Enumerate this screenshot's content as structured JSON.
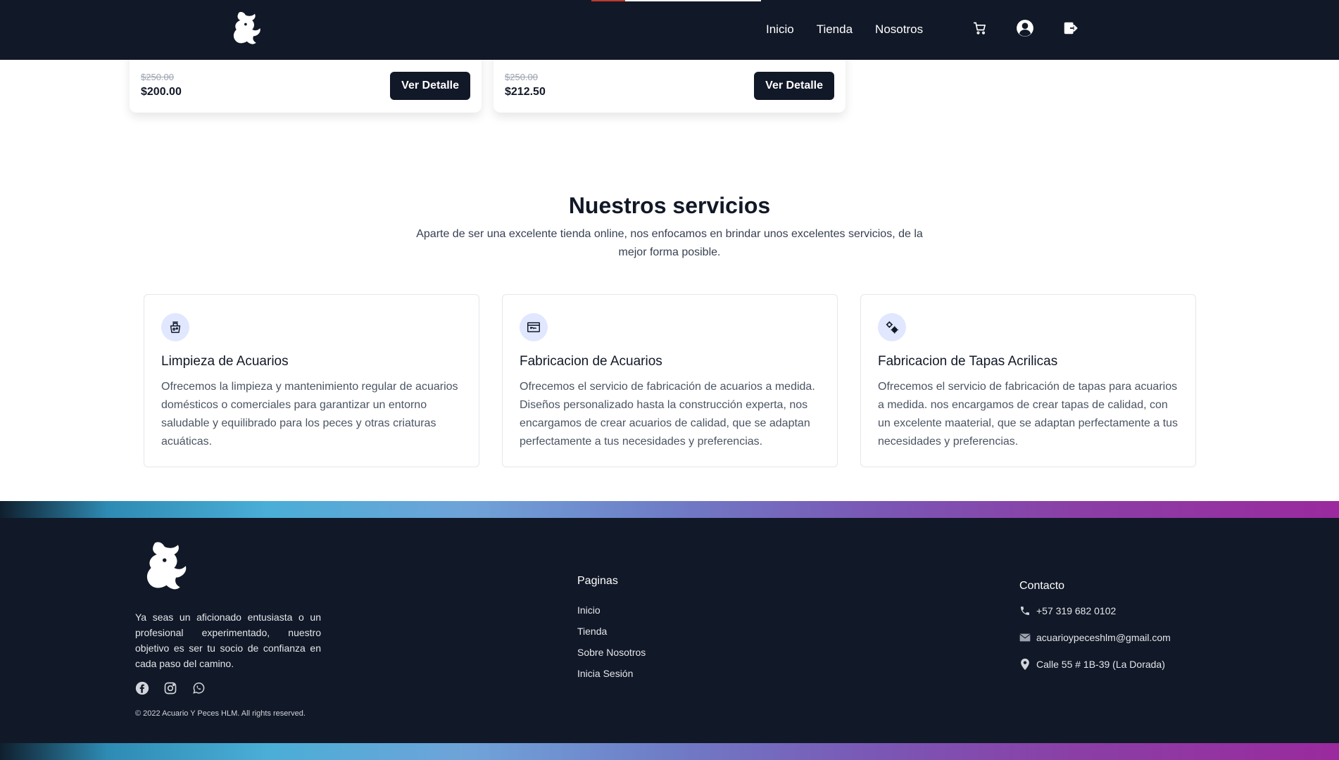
{
  "header": {
    "nav": [
      "Inicio",
      "Tienda",
      "Nosotros"
    ],
    "icons": [
      "cart-icon",
      "user-account-icon",
      "logout-icon"
    ],
    "scroll_progress": 0.2
  },
  "products": [
    {
      "old_price": "$250.00",
      "price": "$200.00",
      "button": "Ver Detalle"
    },
    {
      "old_price": "$250.00",
      "price": "$212.50",
      "button": "Ver Detalle"
    }
  ],
  "services": {
    "title": "Nuestros servicios",
    "subtitle": "Aparte de ser una excelente tienda online, nos enfocamos en brindar unos excelentes servicios, de la mejor forma posible.",
    "items": [
      {
        "icon": "aquarium-cleaning-icon",
        "title": "Limpieza de Acuarios",
        "description": "Ofrecemos la limpieza y mantenimiento regular de acuarios domésticos o comerciales para garantizar un entorno saludable y equilibrado para los peces y otras criaturas acuáticas."
      },
      {
        "icon": "aquarium-tank-icon",
        "title": "Fabricacion de Acuarios",
        "description": "Ofrecemos el servicio de fabricación de acuarios a medida. Diseños personalizado hasta la construcción experta, nos encargamos de crear acuarios de calidad, que se adaptan perfectamente a tus necesidades y preferencias."
      },
      {
        "icon": "gears-icon",
        "title": "Fabricacion de Tapas Acrilicas",
        "description": "Ofrecemos el servicio de fabricación de tapas para acuarios a medida. nos encargamos de crear tapas de calidad, con un excelente maaterial, que se adaptan perfectamente a tus necesidades y preferencias."
      }
    ]
  },
  "footer": {
    "about": "Ya seas un aficionado entusiasta o un profesional experimentado, nuestro objetivo es ser tu socio de confianza en cada paso del camino.",
    "socials": [
      "facebook-icon",
      "instagram-icon",
      "whatsapp-icon"
    ],
    "copyright": "© 2022 Acuario Y Peces HLM. All rights reserved.",
    "pages_title": "Paginas",
    "pages": [
      "Inicio",
      "Tienda",
      "Sobre Nosotros",
      "Inicia Sesión"
    ],
    "contact_title": "Contacto",
    "contact": [
      {
        "icon": "phone-icon",
        "text": "+57 319 682 0102"
      },
      {
        "icon": "mail-icon",
        "text": "acuarioypeceshlm@gmail.com"
      },
      {
        "icon": "location-pin-icon",
        "text": "Calle 55 # 1B-39 (La Dorada)"
      }
    ]
  },
  "colors": {
    "dark": "#111827",
    "icon_bg": "#e0e7ff",
    "gradient": [
      "#2e8bb3",
      "#4aaed6",
      "#6f7cc6",
      "#9a2a9e"
    ]
  }
}
